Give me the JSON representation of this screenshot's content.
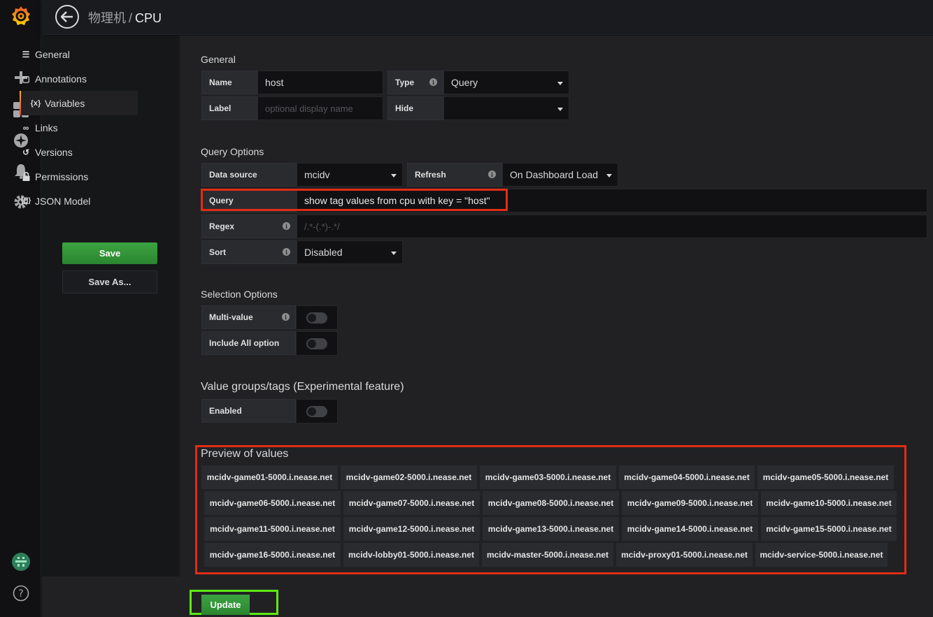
{
  "nav": {
    "icons": [
      "grafana-logo",
      "plus-icon",
      "dashboards-icon",
      "explore-icon",
      "alerting-icon",
      "configuration-icon",
      "user-avatar",
      "help-icon"
    ]
  },
  "header": {
    "folder": "物理机",
    "separator": "/",
    "title": "CPU"
  },
  "sidebar": {
    "items": [
      {
        "icon": "sliders-icon",
        "glyph": "☰",
        "label": "General"
      },
      {
        "icon": "comment-icon",
        "glyph": "▢",
        "label": "Annotations"
      },
      {
        "icon": "variable-icon",
        "glyph": "{x}",
        "label": "Variables"
      },
      {
        "icon": "link-icon",
        "glyph": "∞",
        "label": "Links"
      },
      {
        "icon": "history-icon",
        "glyph": "↺",
        "label": "Versions"
      },
      {
        "icon": "lock-icon",
        "glyph": "🔒",
        "label": "Permissions"
      },
      {
        "icon": "json-icon",
        "glyph": "{[]}",
        "label": "JSON Model"
      }
    ],
    "save_label": "Save",
    "save_as_label": "Save As..."
  },
  "general": {
    "heading": "General",
    "name_label": "Name",
    "name_value": "host",
    "type_label": "Type",
    "type_value": "Query",
    "label_label": "Label",
    "label_placeholder": "optional display name",
    "hide_label": "Hide",
    "hide_value": ""
  },
  "query_options": {
    "heading": "Query Options",
    "datasource_label": "Data source",
    "datasource_value": "mcidv",
    "refresh_label": "Refresh",
    "refresh_value": "On Dashboard Load",
    "query_label": "Query",
    "query_value": "show tag values from cpu with key = \"host\"",
    "regex_label": "Regex",
    "regex_placeholder": "/.*-(.*)-.*/",
    "sort_label": "Sort",
    "sort_value": "Disabled"
  },
  "selection_options": {
    "heading": "Selection Options",
    "multi_label": "Multi-value",
    "multi_enabled": false,
    "all_label": "Include All option",
    "all_enabled": false
  },
  "value_groups": {
    "heading": "Value groups/tags (Experimental feature)",
    "enabled_label": "Enabled",
    "enabled": false
  },
  "preview": {
    "heading": "Preview of values",
    "values": [
      "mcidv-game01-5000.i.nease.net",
      "mcidv-game02-5000.i.nease.net",
      "mcidv-game03-5000.i.nease.net",
      "mcidv-game04-5000.i.nease.net",
      "mcidv-game05-5000.i.nease.net",
      "mcidv-game06-5000.i.nease.net",
      "mcidv-game07-5000.i.nease.net",
      "mcidv-game08-5000.i.nease.net",
      "mcidv-game09-5000.i.nease.net",
      "mcidv-game10-5000.i.nease.net",
      "mcidv-game11-5000.i.nease.net",
      "mcidv-game12-5000.i.nease.net",
      "mcidv-game13-5000.i.nease.net",
      "mcidv-game14-5000.i.nease.net",
      "mcidv-game15-5000.i.nease.net",
      "mcidv-game16-5000.i.nease.net",
      "mcidv-lobby01-5000.i.nease.net",
      "mcidv-master-5000.i.nease.net",
      "mcidv-proxy01-5000.i.nease.net",
      "mcidv-service-5000.i.nease.net"
    ]
  },
  "update_label": "Update",
  "colors": {
    "accent_highlight": "#e22c14",
    "update_highlight": "#5ee914",
    "primary_button": "#3ca341"
  }
}
